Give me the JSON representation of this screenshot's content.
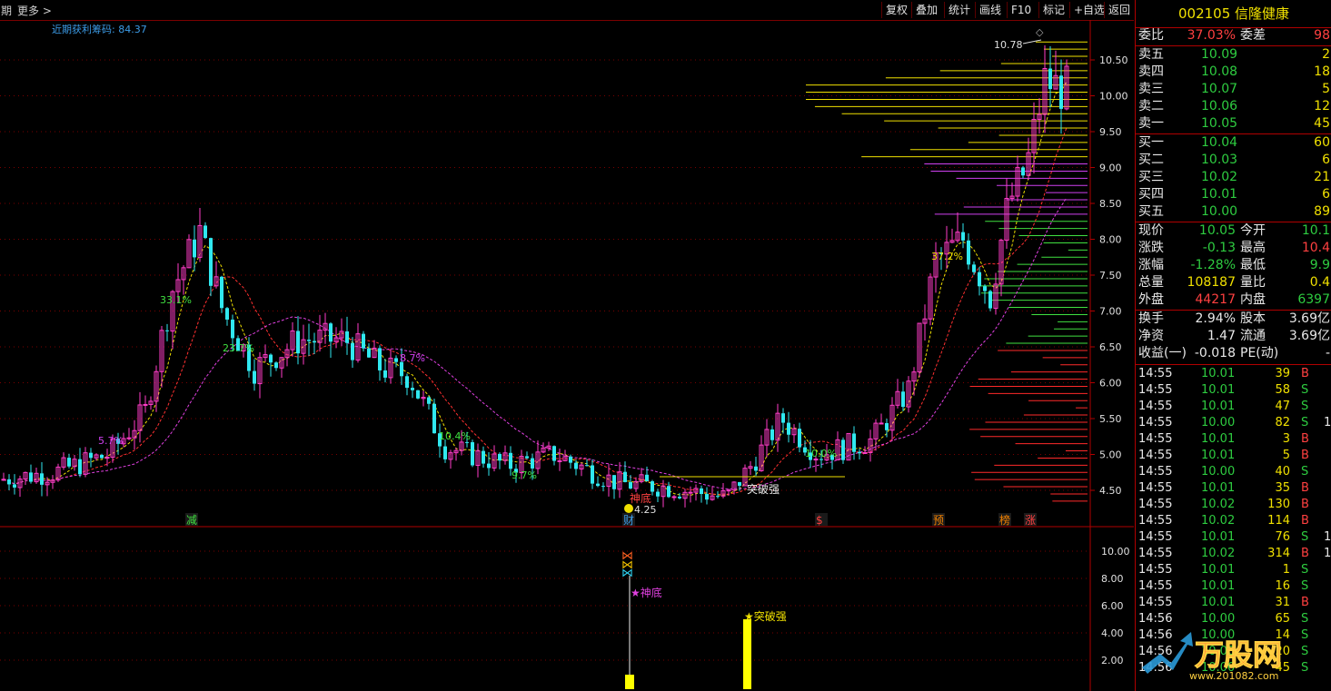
{
  "toolbar": {
    "period_label": "期",
    "more_label": "更多 >",
    "buttons": [
      "复权",
      "叠加",
      "统计",
      "画线",
      "F10",
      "标记",
      "+自选",
      "返回"
    ]
  },
  "chart": {
    "chip_info": "近期获利筹码: 84.37",
    "high_label": "10.78",
    "low_label": "4.25",
    "price_axis": [
      "10.50",
      "10.00",
      "9.50",
      "9.00",
      "8.50",
      "8.00",
      "7.50",
      "7.00",
      "6.50",
      "6.00",
      "5.50",
      "5.00",
      "4.50"
    ],
    "pct_labels": [
      "33.1%",
      "23.7%",
      "5.7%",
      "8.7%",
      "10.4%",
      "9.7%",
      "10.0%",
      "37.2%"
    ],
    "signal_labels": [
      "神底",
      "突破强"
    ],
    "markers": [
      "减",
      "财",
      "$",
      "预",
      "榜",
      "涨"
    ],
    "indicator_axis": [
      "10.00",
      "8.00",
      "6.00",
      "4.00",
      "2.00"
    ],
    "indicator_labels": [
      "★神底",
      "★突破强"
    ],
    "colors": {
      "up": "#ff3cc8",
      "down": "#30e8f0",
      "axis": "#b00000",
      "grid": "#7a0000"
    }
  },
  "panel": {
    "title": "002105 信隆健康",
    "wei": {
      "label": "委比",
      "value": "37.03%",
      "label2": "委差",
      "value2": "98"
    },
    "sells": [
      {
        "label": "卖五",
        "price": "10.09",
        "vol": "2"
      },
      {
        "label": "卖四",
        "price": "10.08",
        "vol": "18"
      },
      {
        "label": "卖三",
        "price": "10.07",
        "vol": "5"
      },
      {
        "label": "卖二",
        "price": "10.06",
        "vol": "12"
      },
      {
        "label": "卖一",
        "price": "10.05",
        "vol": "45"
      }
    ],
    "buys": [
      {
        "label": "买一",
        "price": "10.04",
        "vol": "60"
      },
      {
        "label": "买二",
        "price": "10.03",
        "vol": "6"
      },
      {
        "label": "买三",
        "price": "10.02",
        "vol": "21"
      },
      {
        "label": "买四",
        "price": "10.01",
        "vol": "6"
      },
      {
        "label": "买五",
        "price": "10.00",
        "vol": "89"
      }
    ],
    "quote": [
      {
        "l1": "现价",
        "v1": "10.05",
        "c1": "green",
        "l2": "今开",
        "v2": "10.1",
        "c2": "green"
      },
      {
        "l1": "涨跌",
        "v1": "-0.13",
        "c1": "green",
        "l2": "最高",
        "v2": "10.4",
        "c2": "red"
      },
      {
        "l1": "涨幅",
        "v1": "-1.28%",
        "c1": "green",
        "l2": "最低",
        "v2": "9.9",
        "c2": "green"
      },
      {
        "l1": "总量",
        "v1": "108187",
        "c1": "yellow",
        "l2": "量比",
        "v2": "0.4",
        "c2": "yellow"
      },
      {
        "l1": "外盘",
        "v1": "44217",
        "c1": "red",
        "l2": "内盘",
        "v2": "6397",
        "c2": "green"
      }
    ],
    "fund": [
      {
        "l1": "换手",
        "v1": "2.94%",
        "l2": "股本",
        "v2": "3.69亿"
      },
      {
        "l1": "净资",
        "v1": "1.47",
        "l2": "流通",
        "v2": "3.69亿"
      },
      {
        "l1": "收益(一)",
        "v1": "-0.018",
        "l2": "PE(动)",
        "v2": "-"
      }
    ],
    "ticks": [
      {
        "time": "14:55",
        "price": "10.01",
        "vol": "39",
        "bs": "B",
        "extra": ""
      },
      {
        "time": "14:55",
        "price": "10.01",
        "vol": "58",
        "bs": "S",
        "extra": ""
      },
      {
        "time": "14:55",
        "price": "10.01",
        "vol": "47",
        "bs": "S",
        "extra": ""
      },
      {
        "time": "14:55",
        "price": "10.00",
        "vol": "82",
        "bs": "S",
        "extra": "1"
      },
      {
        "time": "14:55",
        "price": "10.01",
        "vol": "3",
        "bs": "B",
        "extra": ""
      },
      {
        "time": "14:55",
        "price": "10.01",
        "vol": "5",
        "bs": "B",
        "extra": ""
      },
      {
        "time": "14:55",
        "price": "10.00",
        "vol": "40",
        "bs": "S",
        "extra": ""
      },
      {
        "time": "14:55",
        "price": "10.01",
        "vol": "35",
        "bs": "B",
        "extra": ""
      },
      {
        "time": "14:55",
        "price": "10.02",
        "vol": "130",
        "bs": "B",
        "extra": ""
      },
      {
        "time": "14:55",
        "price": "10.02",
        "vol": "114",
        "bs": "B",
        "extra": ""
      },
      {
        "time": "14:55",
        "price": "10.01",
        "vol": "76",
        "bs": "S",
        "extra": "1"
      },
      {
        "time": "14:55",
        "price": "10.02",
        "vol": "314",
        "bs": "B",
        "extra": "1"
      },
      {
        "time": "14:55",
        "price": "10.01",
        "vol": "1",
        "bs": "S",
        "extra": ""
      },
      {
        "time": "14:55",
        "price": "10.01",
        "vol": "16",
        "bs": "S",
        "extra": ""
      },
      {
        "time": "14:55",
        "price": "10.01",
        "vol": "31",
        "bs": "B",
        "extra": ""
      },
      {
        "time": "14:56",
        "price": "10.00",
        "vol": "65",
        "bs": "S",
        "extra": ""
      },
      {
        "time": "14:56",
        "price": "10.00",
        "vol": "14",
        "bs": "S",
        "extra": ""
      },
      {
        "time": "14:56",
        "price": "10.00",
        "vol": "20",
        "bs": "S",
        "extra": ""
      },
      {
        "time": "14:56",
        "price": "10.00",
        "vol": "45",
        "bs": "S",
        "extra": ""
      }
    ]
  },
  "watermark": {
    "brand": "万股网",
    "url": "www.201082.com"
  }
}
